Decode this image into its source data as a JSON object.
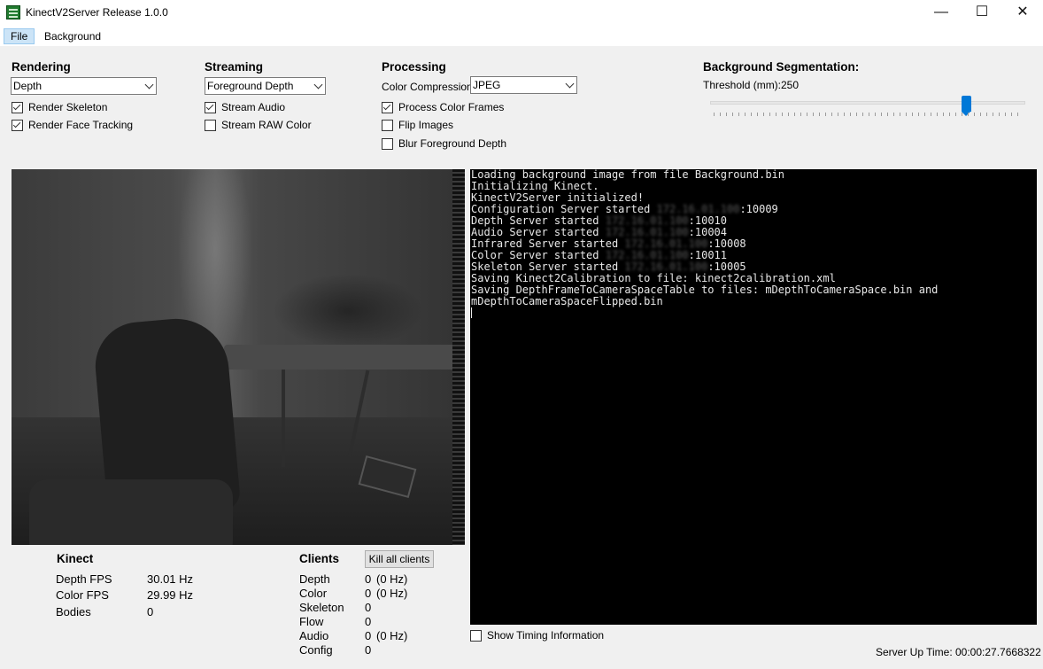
{
  "window": {
    "title": "KinectV2Server Release 1.0.0",
    "minimize": "—",
    "maximize": "☐",
    "close": "✕"
  },
  "menu": {
    "file": "File",
    "background": "Background"
  },
  "rendering": {
    "title": "Rendering",
    "mode": "Depth",
    "render_skeleton": {
      "label": "Render Skeleton",
      "checked": true
    },
    "render_face": {
      "label": "Render Face Tracking",
      "checked": true
    }
  },
  "streaming": {
    "title": "Streaming",
    "mode": "Foreground Depth",
    "stream_audio": {
      "label": "Stream Audio",
      "checked": true
    },
    "stream_raw": {
      "label": "Stream RAW Color",
      "checked": false
    }
  },
  "processing": {
    "title": "Processing",
    "compression_label": "Color Compression:",
    "compression": "JPEG",
    "process_color": {
      "label": "Process Color Frames",
      "checked": true
    },
    "flip_images": {
      "label": "Flip Images",
      "checked": false
    },
    "blur_depth": {
      "label": "Blur Foreground Depth",
      "checked": false
    }
  },
  "segmentation": {
    "title": "Background Segmentation:",
    "threshold_label": "Threshold (mm):",
    "threshold_value": "250",
    "slider_fraction": 0.82
  },
  "console": {
    "lines": [
      {
        "text": "Loading background image from file Background.bin"
      },
      {
        "text": "Initializing Kinect."
      },
      {
        "text": "KinectV2Server initialized!"
      },
      {
        "prefix": "Configuration Server started ",
        "hidden": "172.16.01.100",
        "suffix": ":10009"
      },
      {
        "prefix": "Depth Server started ",
        "hidden": "172.16.01.100",
        "suffix": ":10010"
      },
      {
        "prefix": "Audio Server started ",
        "hidden": "172.16.01.100",
        "suffix": ":10004"
      },
      {
        "prefix": "Infrared Server started ",
        "hidden": "172.16.01.100",
        "suffix": ":10008"
      },
      {
        "prefix": "Color Server started ",
        "hidden": "172.16.01.100",
        "suffix": ":10011"
      },
      {
        "prefix": "Skeleton Server started ",
        "hidden": "172.16.01.100",
        "suffix": ":10005"
      },
      {
        "text": "Saving Kinect2Calibration to file: kinect2calibration.xml"
      },
      {
        "text": "Saving DepthFrameToCameraSpaceTable to files: mDepthToCameraSpace.bin and"
      },
      {
        "text": "mDepthToCameraSpaceFlipped.bin"
      }
    ]
  },
  "kinect": {
    "title": "Kinect",
    "depth_fps_label": "Depth FPS",
    "depth_fps": "30.01 Hz",
    "color_fps_label": "Color FPS",
    "color_fps": "29.99 Hz",
    "bodies_label": "Bodies",
    "bodies": "0"
  },
  "clients": {
    "title": "Clients",
    "kill_button": "Kill all clients",
    "rows": [
      {
        "label": "Depth",
        "count": "0",
        "rate": "(0 Hz)"
      },
      {
        "label": "Color",
        "count": "0",
        "rate": "(0 Hz)"
      },
      {
        "label": "Skeleton",
        "count": "0",
        "rate": ""
      },
      {
        "label": "Flow",
        "count": "0",
        "rate": ""
      },
      {
        "label": "Audio",
        "count": "0",
        "rate": "(0 Hz)"
      },
      {
        "label": "Config",
        "count": "0",
        "rate": ""
      }
    ]
  },
  "footer": {
    "show_timing": {
      "label": "Show Timing Information",
      "checked": false
    },
    "uptime_label": "Server Up Time:",
    "uptime": "00:00:27.7668322"
  },
  "colors": {
    "accent": "#0078d7",
    "console_bg": "#000000",
    "console_fg": "#e8e8e8",
    "window_bg": "#f0f0f0"
  },
  "icons": {
    "app": "kinect-app-icon",
    "dropdown": "chevron-down-icon",
    "check": "checkmark-icon"
  }
}
